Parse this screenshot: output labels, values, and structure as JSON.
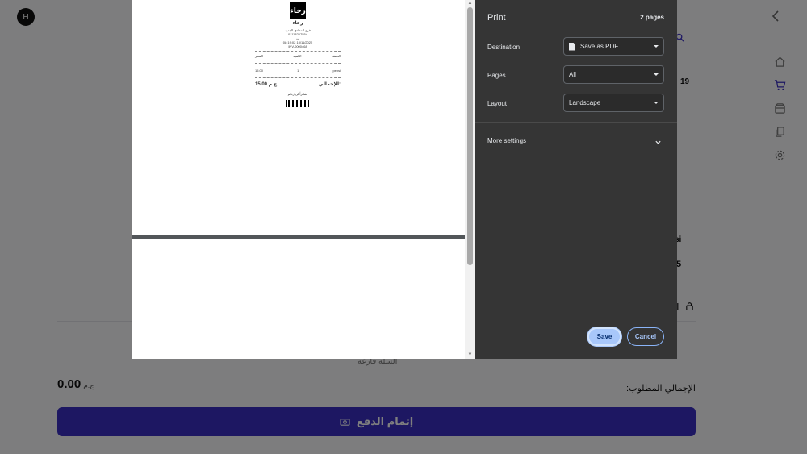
{
  "app": {
    "avatar_initial": "H",
    "fragments": {
      "badge_num": "19",
      "name_frag": "si",
      "price_frag": "5",
      "lock_frag": "I"
    },
    "empty_cart": "السلة فارغة",
    "total_label": "الإجمالي المطلوب:",
    "total_value": "0.00",
    "currency": "ج.م",
    "pay_button": "إتمام الدفع"
  },
  "print": {
    "title": "Print",
    "page_count": "2 pages",
    "destination": {
      "label": "Destination",
      "value": "Save as PDF"
    },
    "pages": {
      "label": "Pages",
      "value": "All"
    },
    "layout": {
      "label": "Layout",
      "value": "Landscape"
    },
    "more_settings": "More settings",
    "save": "Save",
    "cancel": "Cancel"
  },
  "receipt": {
    "logo_text": "رخاء",
    "shop_name": "رخاء",
    "lines": [
      "فرع المعادي الجديد",
      "01118267554",
      "ت",
      "08:19:02 10/11/2025",
      "INV-0000468"
    ],
    "headers": [
      "الصنف",
      "الكمية",
      "السعر"
    ],
    "rows": [
      [
        "pepsi",
        "1",
        "15.00"
      ]
    ],
    "total_label": "الإجمالي:",
    "total_value": "15.00 ج.م",
    "thanks": "شكراً لزيارتكم!"
  },
  "colors": {
    "accent": "#3a2fc4",
    "dialog_bg": "#353535",
    "save_button": "#a8c7fa"
  }
}
